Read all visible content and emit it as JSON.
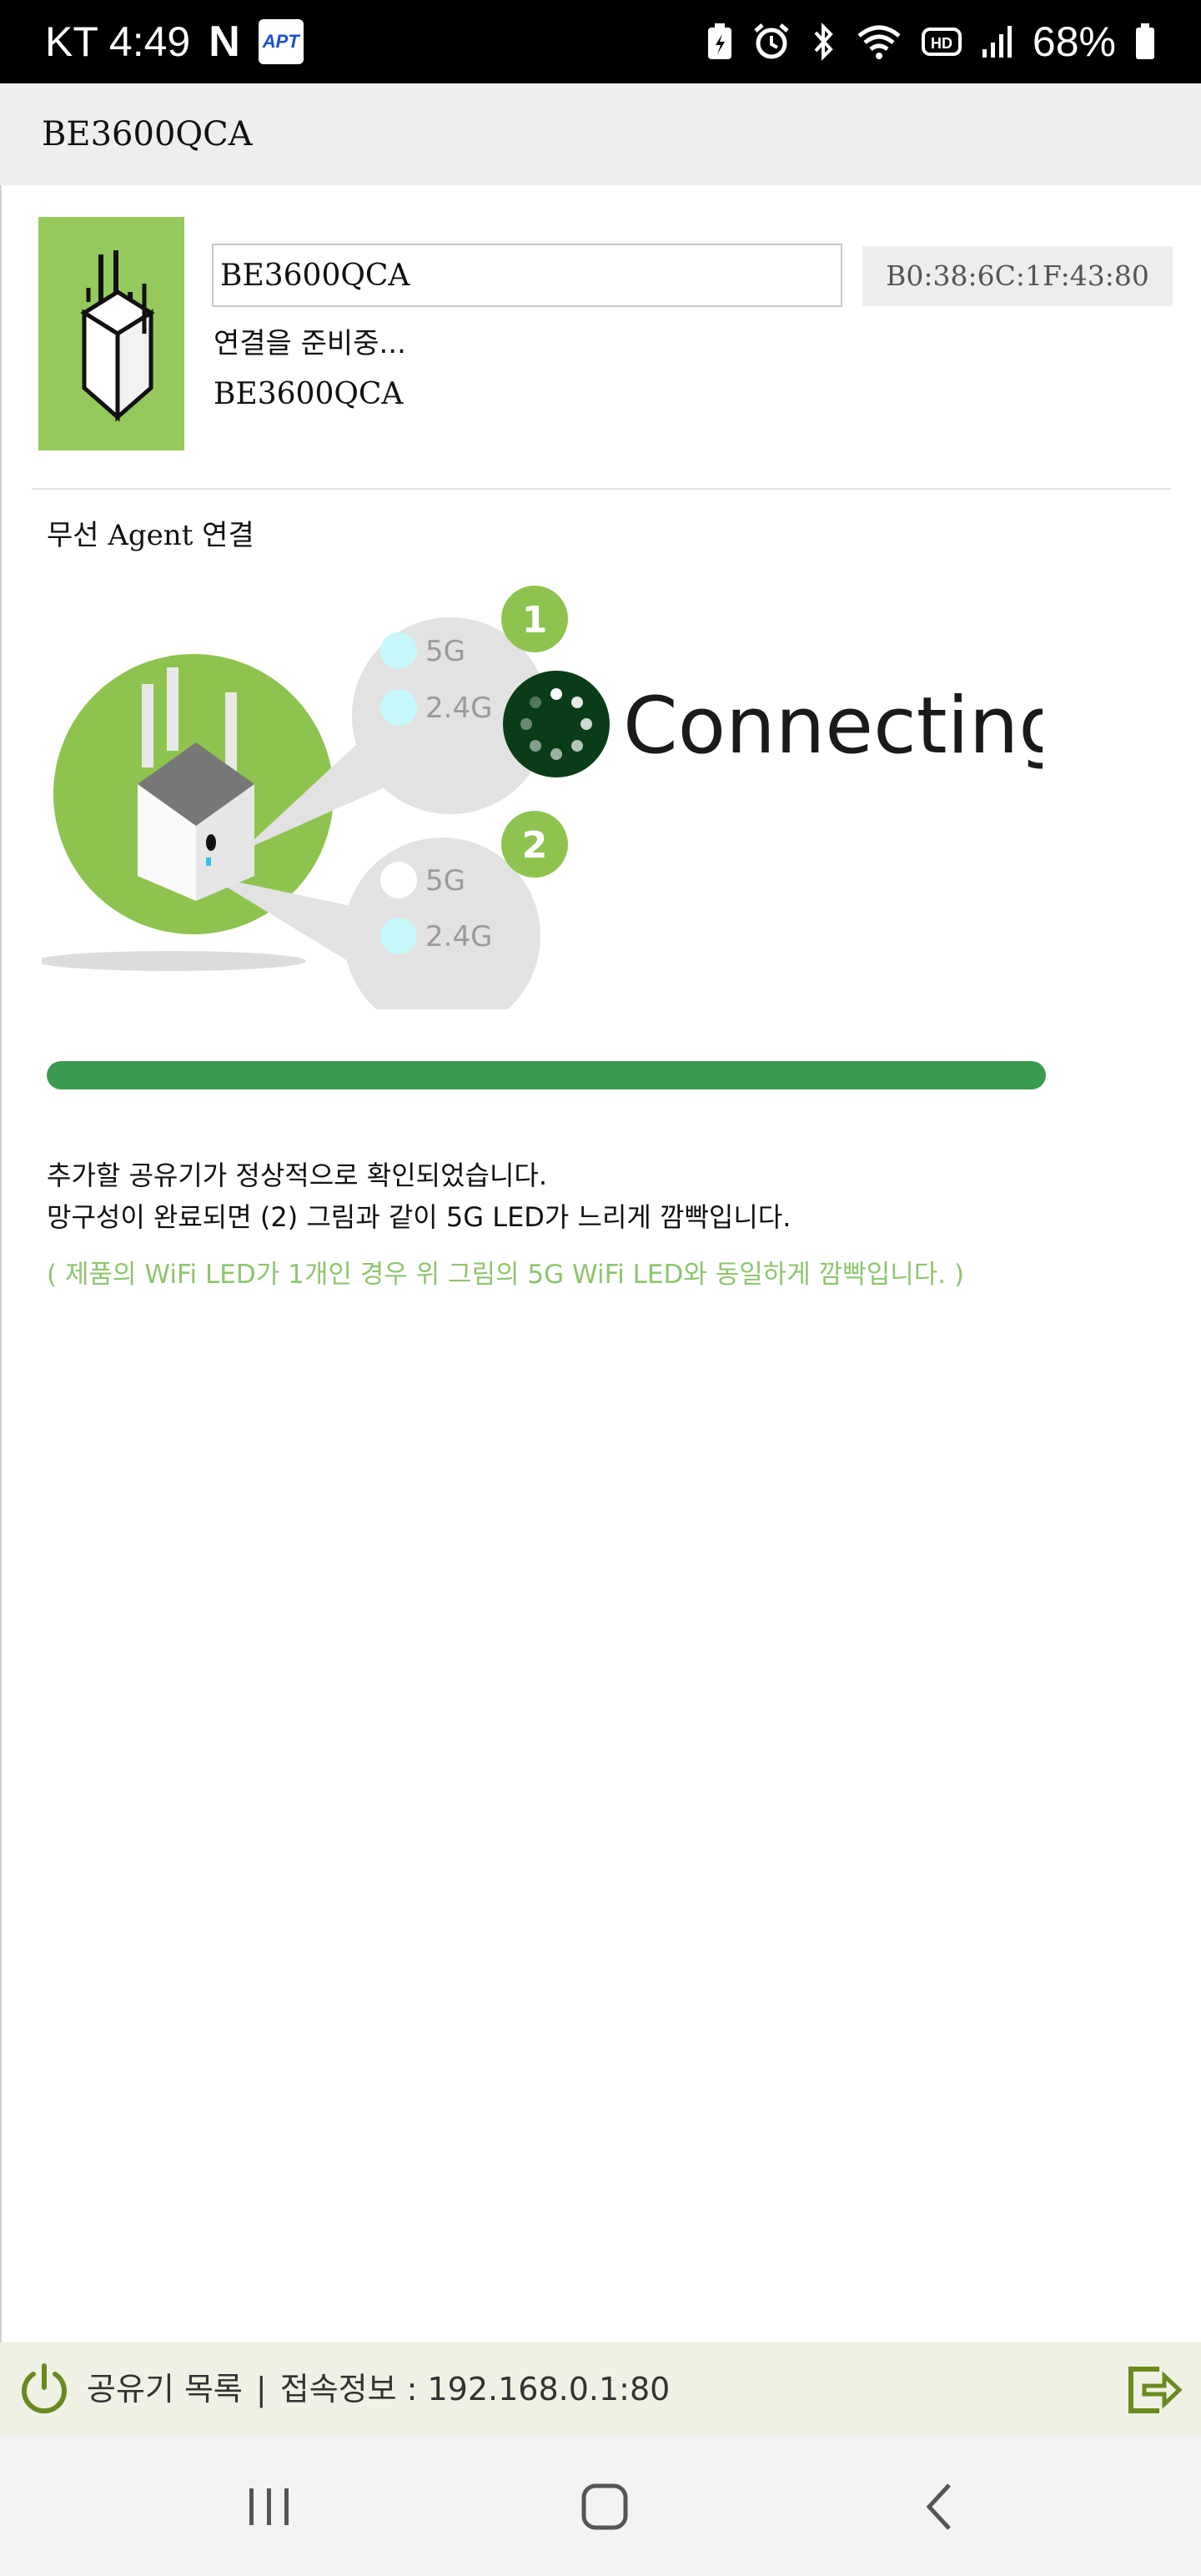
{
  "status_bar": {
    "carrier": "KT",
    "time": "4:49",
    "n_icon": "N",
    "app_icon_text": "APT",
    "battery": "68%",
    "icons": [
      "battery-saver-icon",
      "alarm-icon",
      "bluetooth-icon",
      "wifi-icon",
      "hd-icon",
      "signal-icon",
      "battery-icon"
    ]
  },
  "app_bar": {
    "title": "BE3600QCA"
  },
  "device": {
    "name_value": "BE3600QCA",
    "mac": "B0:38:6C:1F:43:80",
    "status": "연결을 준비중...",
    "model": "BE3600QCA",
    "thumb_color": "#95c95b"
  },
  "section": {
    "title": "무선 Agent 연결"
  },
  "illustration": {
    "step1_number": "1",
    "step2_number": "2",
    "led_5g": "5G",
    "led_24g": "2.4G",
    "connecting_label": "Connecting",
    "accent_green": "#8fc34f",
    "spinner_color": "#0a3d17",
    "led_color": "#c6f7fb"
  },
  "progress": {
    "fraction": 1.0,
    "color": "#3a9a4f"
  },
  "messages": {
    "line1": "추가할 공유기가 정상적으로 확인되었습니다.",
    "line2": "망구성이 완료되면 (2) 그림과 같이 5G LED가 느리게 깜빡입니다.",
    "note": "( 제품의 WiFi LED가 1개인 경우 위 그림의 5G WiFi LED와 동일하게 깜빡입니다. )"
  },
  "footer": {
    "list_label": "공유기 목록",
    "separator": "|",
    "conn_info": "접속정보 : 192.168.0.1:80",
    "accent": "#6a8a1f"
  },
  "nav": {
    "icons": [
      "recent-apps-icon",
      "home-icon",
      "back-icon"
    ]
  }
}
